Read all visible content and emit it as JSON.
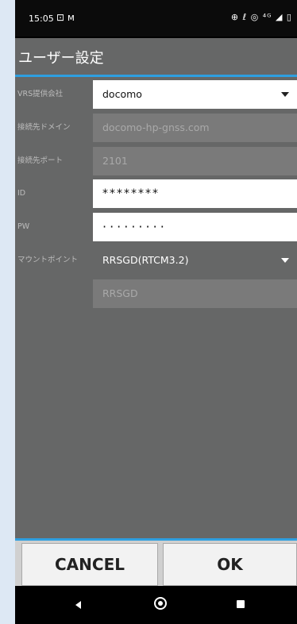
{
  "status_bar": {
    "time": "15:05",
    "left_icons": "⊡ ᴍ",
    "right_icons": "⊕ ℓ ◎ ⁴ᴳ ◢ ▯"
  },
  "dialog": {
    "title": "ユーザー設定",
    "rows": [
      {
        "label": "VRS提供会社",
        "value": "docomo"
      },
      {
        "label": "接続先ドメイン",
        "value": "docomo-hp-gnss.com"
      },
      {
        "label": "接続先ポート",
        "value": "2101"
      },
      {
        "label": "ID",
        "value": "********"
      },
      {
        "label": "PW",
        "value": "·········"
      },
      {
        "label": "マウントポイント",
        "value": "RRSGD(RTCM3.2)"
      },
      {
        "label": "",
        "value": "RRSGD"
      }
    ],
    "buttons": {
      "cancel": "CANCEL",
      "ok": "OK"
    }
  },
  "colors": {
    "accent": "#2e9fe0",
    "dialog_bg": "#666767"
  }
}
